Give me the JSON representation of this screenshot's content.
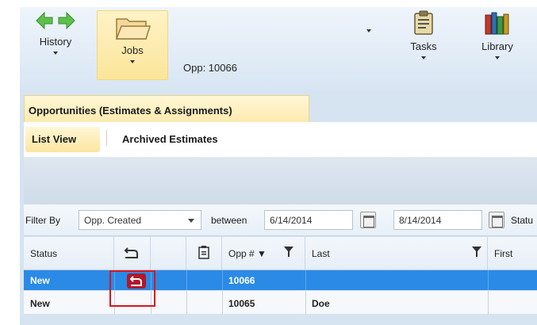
{
  "toolbar": {
    "history_label": "History",
    "jobs_label": "Jobs",
    "opp_label": "Opp: 10066",
    "tasks_label": "Tasks",
    "library_label": "Library"
  },
  "tab": {
    "label": "Opportunities (Estimates & Assignments)"
  },
  "subnav": {
    "list_view": "List View",
    "archived": "Archived Estimates"
  },
  "filter": {
    "filter_by_label": "Filter By",
    "field_value": "Opp. Created",
    "between_label": "between",
    "date_from": "6/14/2014",
    "date_to": "8/14/2014",
    "status_label": "Statu"
  },
  "grid": {
    "columns": [
      "Status",
      "",
      "",
      "",
      "Opp # ▼",
      "Last",
      "First"
    ],
    "rows": [
      {
        "status": "New",
        "opp": "10066",
        "last": "",
        "first": ""
      },
      {
        "status": "New",
        "opp": "10065",
        "last": "Doe",
        "first": ""
      }
    ]
  },
  "colors": {
    "accent": "#2a8ae6",
    "highlight": "#d6171f",
    "badge": "#b2182b"
  }
}
